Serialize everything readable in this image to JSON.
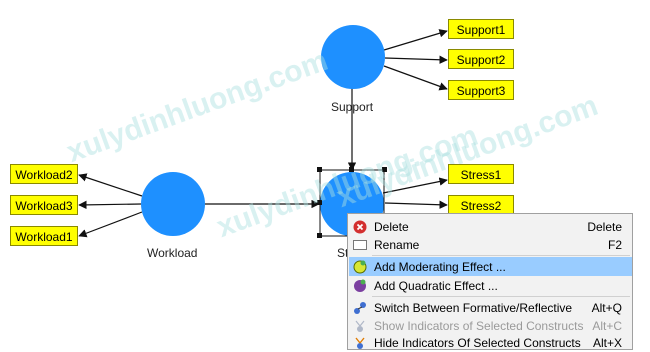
{
  "watermark": "xulydinhluong.com",
  "constructs": {
    "workload": "Workload",
    "support": "Support",
    "stress": "St"
  },
  "indicators": {
    "support": [
      "Support1",
      "Support2",
      "Support3"
    ],
    "workload": [
      "Workload2",
      "Workload3",
      "Workload1"
    ],
    "stress": [
      "Stress1",
      "Stress2"
    ]
  },
  "context_menu": {
    "items": [
      {
        "label": "Delete",
        "shortcut": "Delete",
        "icon": "delete-icon",
        "highlighted": false,
        "disabled": false
      },
      {
        "label": "Rename",
        "shortcut": "F2",
        "icon": "rename-icon",
        "highlighted": false,
        "disabled": false
      },
      {
        "label": "Add Moderating Effect ...",
        "shortcut": "",
        "icon": "moderating-effect-icon",
        "highlighted": true,
        "disabled": false
      },
      {
        "label": "Add Quadratic Effect ...",
        "shortcut": "",
        "icon": "quadratic-effect-icon",
        "highlighted": false,
        "disabled": false
      },
      {
        "label": "Switch Between Formative/Reflective",
        "shortcut": "Alt+Q",
        "icon": "switch-icon",
        "highlighted": false,
        "disabled": false
      },
      {
        "label": "Show Indicators of Selected Constructs",
        "shortcut": "Alt+C",
        "icon": "show-indicators-icon",
        "highlighted": false,
        "disabled": true
      },
      {
        "label": "Hide Indicators Of Selected Constructs",
        "shortcut": "Alt+X",
        "icon": "hide-indicators-icon",
        "highlighted": false,
        "disabled": false
      }
    ]
  },
  "colors": {
    "construct": "#1e90ff",
    "indicator": "#ffff00",
    "menu_highlight": "#99ccff",
    "delete_icon": "#d32f2f"
  }
}
